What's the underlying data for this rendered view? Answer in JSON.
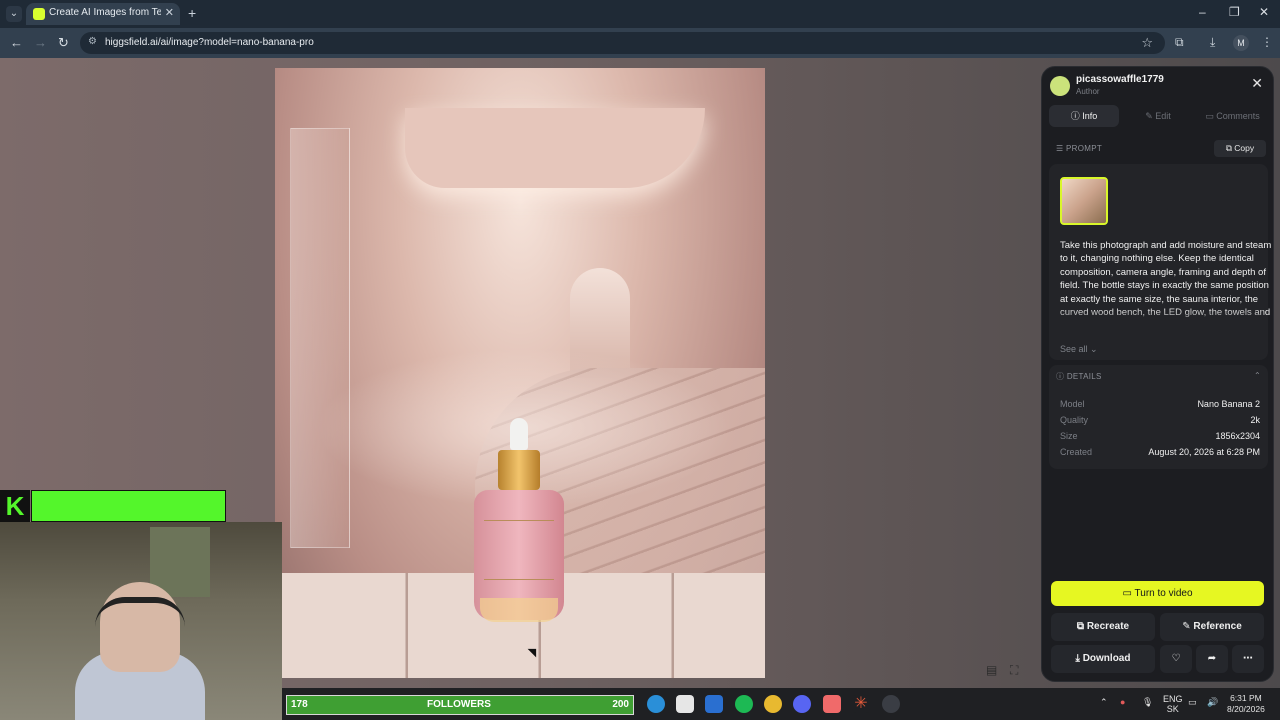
{
  "browser": {
    "tab_title": "Create AI Images from Text & P",
    "url": "higgsfield.ai/ai/image?model=nano-banana-pro",
    "profile_initial": "M"
  },
  "panel": {
    "author_name": "picassowaffle1779",
    "author_role": "Author",
    "tabs": [
      {
        "label": "Info",
        "icon": "info-icon"
      },
      {
        "label": "Edit",
        "icon": "edit-icon"
      },
      {
        "label": "Comments",
        "icon": "comments-icon"
      }
    ],
    "prompt_header": "PROMPT",
    "copy_label": "Copy",
    "prompt_text": "Take this photograph and add moisture and steam to it, changing nothing else. Keep the identical composition, camera angle, framing and depth of field. The bottle stays in exactly the same position at exactly the same size, the sauna interior, the curved wood bench, the LED glow, the towels and",
    "see_all": "See all",
    "details_header": "DETAILS",
    "details": [
      {
        "key": "Model",
        "value": "Nano Banana 2"
      },
      {
        "key": "Quality",
        "value": "2k"
      },
      {
        "key": "Size",
        "value": "1856x2304"
      },
      {
        "key": "Created",
        "value": "August 20, 2026 at 6:28 PM"
      }
    ],
    "turn_to_video": "Turn to video",
    "recreate": "Recreate",
    "reference": "Reference",
    "download": "Download"
  },
  "overlay": {
    "followers_count": "178",
    "followers_label": "FOLLOWERS",
    "followers_goal": "200"
  },
  "taskbar": {
    "lang_top": "ENG",
    "lang_bottom": "SK",
    "time": "6:31 PM",
    "date": "8/20/2026"
  },
  "colors": {
    "accent": "#e6f722",
    "overlay_green": "#54f62b"
  }
}
